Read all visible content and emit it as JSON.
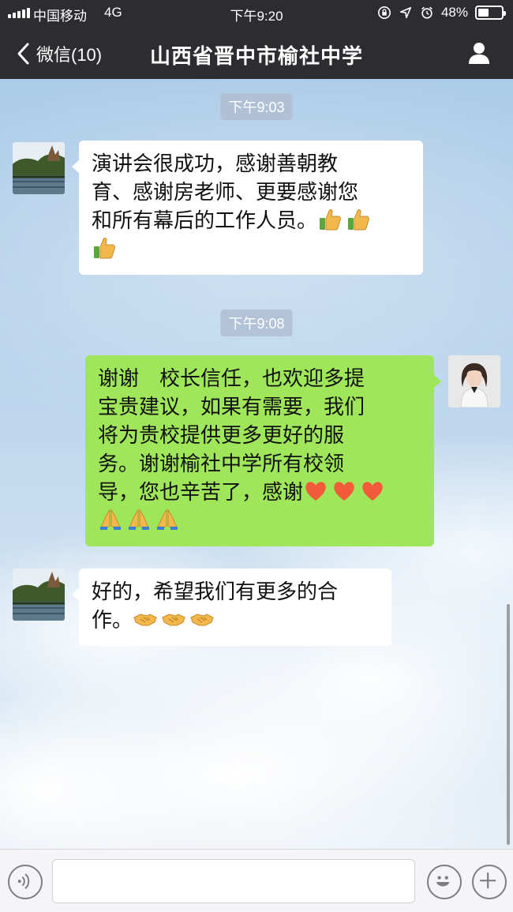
{
  "status_bar": {
    "carrier": "中国移动",
    "network": "4G",
    "time": "下午9:20",
    "battery_percent_text": "48%",
    "battery_level": 0.48,
    "icons": [
      "orientation-lock-icon",
      "location-icon",
      "alarm-icon",
      "battery-icon"
    ]
  },
  "nav": {
    "back_label": "微信(10)",
    "title": "山西省晋中市榆社中学",
    "profile_icon": "person-icon"
  },
  "messages": [
    {
      "type": "time",
      "text": "下午9:03"
    },
    {
      "type": "received",
      "avatar": "landscape-avatar",
      "lines": [
        "演讲会很成功，感谢善朝教",
        "育、感谢房老师、更要感谢您",
        "和所有幕后的工作人员。"
      ],
      "emoji_inline": [
        "thumbs-up",
        "thumbs-up"
      ],
      "emoji_line": [
        "thumbs-up"
      ]
    },
    {
      "type": "time",
      "text": "下午9:08"
    },
    {
      "type": "sent",
      "avatar": "woman-portrait-avatar",
      "lines": [
        "谢谢　校长信任，也欢迎多提",
        "宝贵建议，如果有需要，我们",
        "将为贵校提供更多更好的服",
        "务。谢谢榆社中学所有校领",
        "导，您也辛苦了，感谢"
      ],
      "emoji_inline": [
        "heart",
        "heart",
        "heart"
      ],
      "emoji_line": [
        "folded-hands",
        "folded-hands",
        "folded-hands"
      ]
    },
    {
      "type": "received",
      "avatar": "landscape-avatar",
      "lines": [
        "好的，希望我们有更多的合",
        "作。"
      ],
      "emoji_inline": [
        "handshake",
        "handshake",
        "handshake"
      ]
    }
  ],
  "input": {
    "value": "",
    "placeholder": ""
  },
  "colors": {
    "bar": "#2d2d31",
    "sent_bubble": "#9fe65b",
    "received_bubble": "#ffffff",
    "time_pill": "#afbed2"
  }
}
